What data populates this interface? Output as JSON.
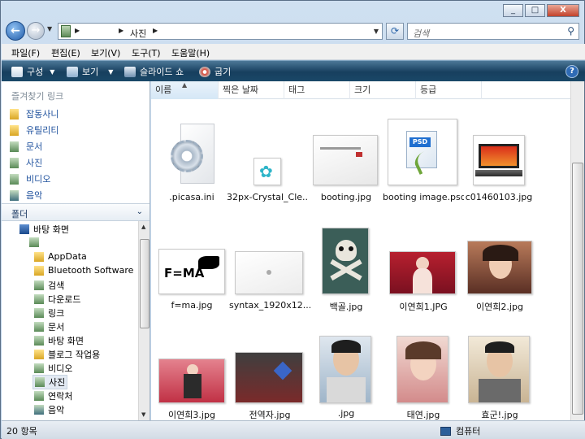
{
  "window": {
    "caption_buttons": [
      "_",
      "□",
      "X"
    ]
  },
  "nav": {
    "back_glyph": "←",
    "forward_glyph": "→",
    "breadcrumb": "사진",
    "search_placeholder": "검색"
  },
  "menu": [
    "파일(F)",
    "편집(E)",
    "보기(V)",
    "도구(T)",
    "도움말(H)"
  ],
  "toolbar": {
    "organize": "구성",
    "view": "보기",
    "slideshow": "슬라이드 쇼",
    "burn": "굽기",
    "help": "?"
  },
  "favorites": {
    "title": "즐겨찾기 링크",
    "items": [
      "잡동사니",
      "유틸리티",
      "문서",
      "사진",
      "비디오",
      "음악"
    ]
  },
  "folders": {
    "title": "폴더",
    "tree": [
      "바탕 화면",
      "",
      "AppData",
      "Bluetooth Software",
      "검색",
      "다운로드",
      "링크",
      "문서",
      "바탕 화면",
      "블로그 작업용",
      "비디오",
      "사진",
      "연락처",
      "음악"
    ]
  },
  "columns": [
    "이름",
    "찍은 날짜",
    "태그",
    "크기",
    "등급"
  ],
  "files": [
    {
      "name": ".picasa.ini"
    },
    {
      "name": "32px-Crystal_Cle..."
    },
    {
      "name": "booting.jpg"
    },
    {
      "name": "booting image.psd"
    },
    {
      "name": "c01460103.jpg"
    },
    {
      "name": "f=ma.jpg"
    },
    {
      "name": "syntax_1920x12..."
    },
    {
      "name": "백골.jpg"
    },
    {
      "name": "이연희1.JPG"
    },
    {
      "name": "이연희2.jpg"
    },
    {
      "name": "이연희3.jpg"
    },
    {
      "name": "전역자.jpg"
    },
    {
      "name": ".jpg"
    },
    {
      "name": "태연.jpg"
    },
    {
      "name": "효군!.jpg"
    }
  ],
  "status": {
    "count": "20 항목",
    "location": "컴퓨터"
  },
  "colors": {
    "toolbar": "#1a4868",
    "link": "#1c4f9c"
  }
}
